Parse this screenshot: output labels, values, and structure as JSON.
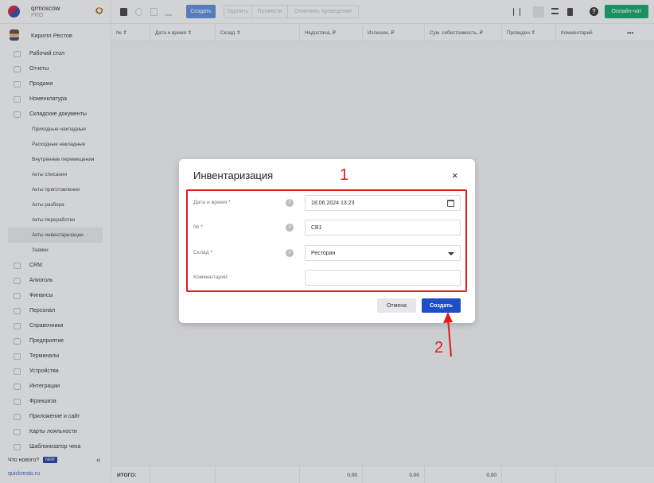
{
  "brand": {
    "name": "qrmoscow",
    "plan": "PRO"
  },
  "user": {
    "name": "Кирилл Рестов"
  },
  "sidebar": {
    "items": [
      {
        "label": "Рабочий стол"
      },
      {
        "label": "Отчеты"
      },
      {
        "label": "Продажи"
      },
      {
        "label": "Номенклатура"
      },
      {
        "label": "Складские документы"
      }
    ],
    "subitems": [
      {
        "label": "Приходные накладные"
      },
      {
        "label": "Расходные накладные"
      },
      {
        "label": "Внутренние перемещения"
      },
      {
        "label": "Акты списания"
      },
      {
        "label": "Акты приготовления"
      },
      {
        "label": "Акты разбора"
      },
      {
        "label": "Акты переработки"
      },
      {
        "label": "Акты инвентаризации"
      },
      {
        "label": "Заявки"
      }
    ],
    "items_after": [
      {
        "label": "CRM"
      },
      {
        "label": "Алкоголь"
      },
      {
        "label": "Финансы"
      },
      {
        "label": "Персонал"
      },
      {
        "label": "Справочники"
      },
      {
        "label": "Предприятие"
      },
      {
        "label": "Терминалы"
      },
      {
        "label": "Устройства"
      },
      {
        "label": "Интеграции"
      },
      {
        "label": "Франшиза"
      },
      {
        "label": "Приложение и сайт"
      },
      {
        "label": "Карты лояльности"
      },
      {
        "label": "Шаблонизатор чека"
      }
    ],
    "whats_new": "Что нового?",
    "new_badge": "NEW",
    "site_link": "quickresto.ru"
  },
  "toolbar": {
    "create": "Создать",
    "delete": "Удалить",
    "post": "Провести",
    "unpost": "Отменить проведение",
    "help": "?",
    "online_chat": "Онлайн-чат"
  },
  "table": {
    "columns": [
      "№ ⇕",
      "Дата и время ⇕",
      "Склад ⇕",
      "Недостача, ₽",
      "Излишек, ₽",
      "Сум. себестоимость, ₽",
      "Проведен ⇕",
      "Комментарий"
    ],
    "more": "•••",
    "footer": {
      "label": "ИТОГО:",
      "shortage": "0,00",
      "surplus": "0,00",
      "cost": "0,00"
    }
  },
  "modal": {
    "title": "Инвентаризация",
    "close": "×",
    "fields": {
      "datetime": {
        "label": "Дата и время",
        "value": "18.06.2024 13:23"
      },
      "number": {
        "label": "№",
        "value": "СВ1"
      },
      "warehouse": {
        "label": "Склад",
        "value": "Ресторан"
      },
      "comment": {
        "label": "Комментарий",
        "value": ""
      }
    },
    "required_mark": "*",
    "cancel": "Отмена",
    "submit": "Создать"
  },
  "annotations": {
    "label1": "1",
    "label2": "2"
  },
  "colors": {
    "accent": "#1c4fc4",
    "chat": "#16a36b",
    "annotation": "#e01c1c"
  }
}
